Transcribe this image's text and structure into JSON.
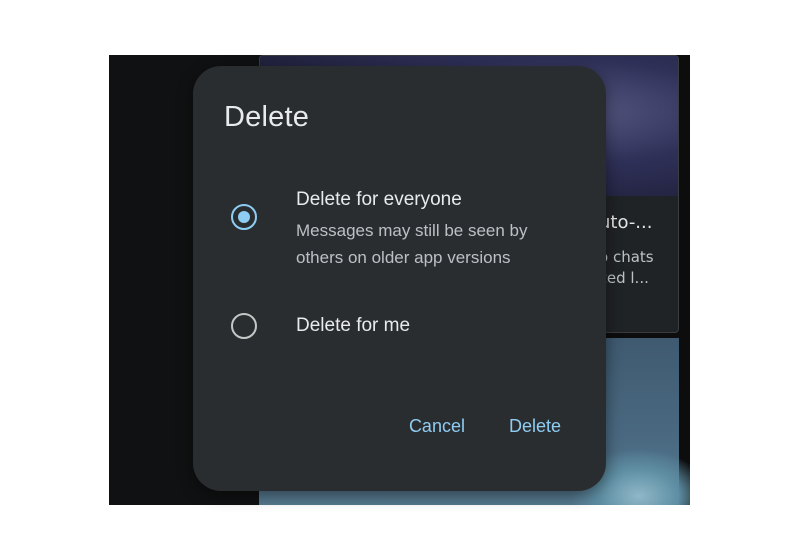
{
  "background": {
    "card_title": "uto-...",
    "card_text_line1": "o chats",
    "card_text_line2": "zed l..."
  },
  "dialog": {
    "title": "Delete",
    "options": [
      {
        "label": "Delete for everyone",
        "description": "Messages may still be seen by others on older app versions",
        "selected": true
      },
      {
        "label": "Delete for me",
        "selected": false
      }
    ],
    "cancel_label": "Cancel",
    "delete_label": "Delete"
  },
  "colors": {
    "accent": "#8ecdf3",
    "dialog_bg": "#2a2d30",
    "text_primary": "#e8eaed",
    "text_secondary": "#bcc0c4"
  }
}
